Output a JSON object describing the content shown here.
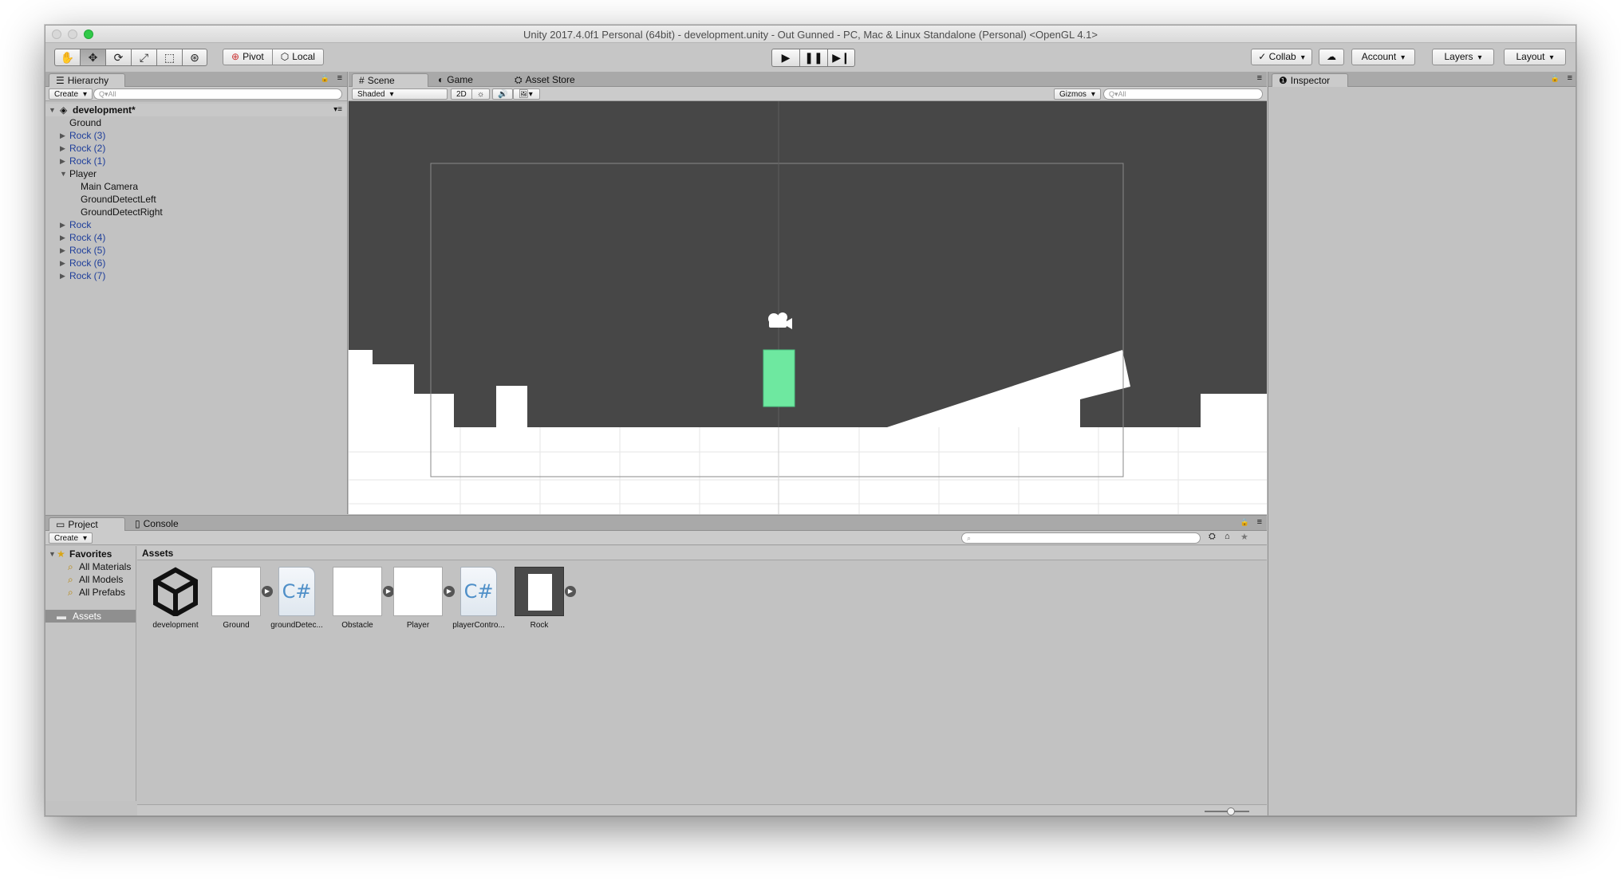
{
  "window": {
    "title": "Unity 2017.4.0f1 Personal (64bit) - development.unity - Out Gunned - PC, Mac & Linux Standalone (Personal) <OpenGL 4.1>"
  },
  "toolbar": {
    "pivot": "Pivot",
    "local": "Local",
    "collab": "Collab",
    "account": "Account",
    "layers": "Layers",
    "layout": "Layout"
  },
  "hierarchy": {
    "tab": "Hierarchy",
    "create": "Create",
    "search_placeholder": "Q▾All",
    "scene": "development*",
    "items": [
      "Ground",
      "Rock (3)",
      "Rock (2)",
      "Rock (1)",
      "Player",
      "Main Camera",
      "GroundDetectLeft",
      "GroundDetectRight",
      "Rock",
      "Rock (4)",
      "Rock (5)",
      "Rock (6)",
      "Rock (7)"
    ]
  },
  "scene_tabs": {
    "scene": "Scene",
    "game": "Game",
    "asset_store": "Asset Store"
  },
  "scene_bar": {
    "shaded": "Shaded",
    "mode2d": "2D",
    "gizmos": "Gizmos",
    "search_placeholder": "Q▾All"
  },
  "inspector": {
    "tab": "Inspector"
  },
  "project": {
    "tab": "Project",
    "console_tab": "Console",
    "create": "Create",
    "favorites": "Favorites",
    "fav_items": [
      "All Materials",
      "All Models",
      "All Prefabs"
    ],
    "assets_folder": "Assets",
    "breadcrumb": "Assets",
    "assets": [
      "development",
      "Ground",
      "groundDetec...",
      "Obstacle",
      "Player",
      "playerContro...",
      "Rock"
    ]
  },
  "colors": {
    "player_block": "#6ee8a0",
    "scene_bg": "#474747",
    "ground": "#ffffff"
  }
}
